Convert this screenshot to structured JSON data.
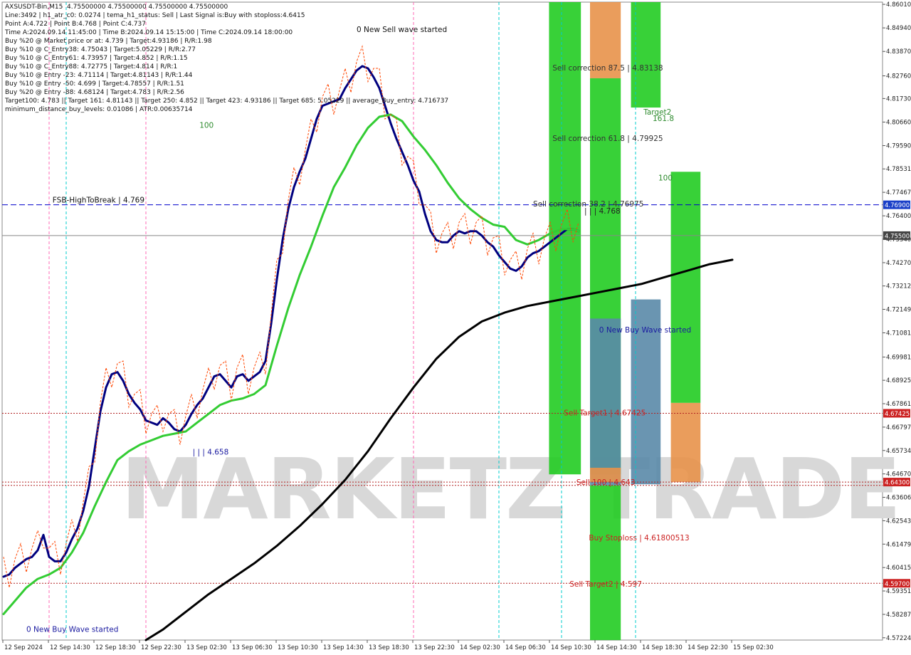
{
  "info_lines": [
    "AXSUSDT-Bin,M15  4.75500000 4.75500000 4.75500000 4.75500000",
    "Line:3492 | h1_atr_c0: 0.0274 | tema_h1_status: Sell | Last Signal is:Buy with stoploss:4.6415",
    "Point A:4.722 | Point B:4.768 | Point C:4.737",
    "Time A:2024.09.14 11:45:00 | Time B:2024.09.14 15:15:00 | Time C:2024.09.14 18:00:00",
    "Buy %20 @ Market price or at: 4.739 | Target:4.93186 | R/R:1.98",
    "Buy %10 @ C_Entry38: 4.75043 | Target:5.05229 | R/R:2.77",
    "Buy %10 @ C_Entry61: 4.73957 | Target:4.852 | R/R:1.15",
    "Buy %10 @ C_Entry88: 4.72775 | Target:4.814 | R/R:1",
    "Buy %10 @ Entry -23: 4.71114 | Target:4.81143 | R/R:1.44",
    "Buy %10 @ Entry -50: 4.699 | Target:4.78557 | R/R:1.51",
    "Buy %20 @ Entry -88: 4.68124 | Target:4.783 | R/R:2.56",
    "Target100: 4.783 || Target 161: 4.81143 || Target 250: 4.852 || Target 423: 4.93186 || Target 685: 5.05229 || average_Buy_entry: 4.716737",
    "minimum_distance_buy_levels: 0.01086 | ATR:0.00635714"
  ],
  "colors": {
    "dark_blue": "#00007f",
    "mid_green": "#33cc33",
    "black_ma": "#000000",
    "orange_dash": "#ff4500",
    "zone_green": "#22cc22",
    "zone_orange": "#e8924a",
    "zone_steel": "#5a8aa8",
    "hline_blue": "#0000cc",
    "hline_red": "#b22222",
    "axis_box_red": "#cc2222",
    "axis_box_blue": "#1a3fc8",
    "axis_box_gray": "#444444",
    "vline_cyan": "#00cccc",
    "vline_pink": "#ff69b4"
  },
  "chart_data": {
    "type": "line",
    "symbol": "AXSUSDT-Bin",
    "timeframe": "M15",
    "y_ticks": [
      "4.86010",
      "4.84940",
      "4.83870",
      "4.82760",
      "4.81730",
      "4.80660",
      "4.79590",
      "4.78531",
      "4.77467",
      "4.76400",
      "4.75340",
      "4.74270",
      "4.73212",
      "4.72149",
      "4.71081",
      "4.69981",
      "4.68925",
      "4.67861",
      "4.66797",
      "4.65734",
      "4.64670",
      "4.63606",
      "4.62543",
      "4.61479",
      "4.60415",
      "4.59351",
      "4.58287",
      "4.57224"
    ],
    "ylim": [
      4.5712,
      4.8611
    ],
    "x_ticks": [
      "12 Sep 2024",
      "12 Sep 14:30",
      "12 Sep 18:30",
      "12 Sep 22:30",
      "13 Sep 02:30",
      "13 Sep 06:30",
      "13 Sep 10:30",
      "13 Sep 14:30",
      "13 Sep 18:30",
      "13 Sep 22:30",
      "14 Sep 02:30",
      "14 Sep 06:30",
      "14 Sep 10:30",
      "14 Sep 14:30",
      "14 Sep 18:30",
      "14 Sep 22:30",
      "15 Sep 02:30"
    ],
    "axis_boxes": [
      {
        "value": "4.76900",
        "color": "#1a3fc8"
      },
      {
        "value": "4.75500",
        "color": "#444444"
      },
      {
        "value": "4.67425",
        "color": "#cc2222"
      },
      {
        "value": "4.64300",
        "color": "#cc2222"
      },
      {
        "value": "4.59700",
        "color": "#cc2222"
      }
    ],
    "series": [
      {
        "key": "tema",
        "color": "#00007f",
        "width": 3,
        "values": [
          [
            0,
            4.6
          ],
          [
            0.5,
            4.601
          ],
          [
            1.0,
            4.604
          ],
          [
            1.5,
            4.606
          ],
          [
            2.0,
            4.608
          ],
          [
            2.5,
            4.609
          ],
          [
            3.0,
            4.612
          ],
          [
            3.5,
            4.619
          ],
          [
            4.0,
            4.609
          ],
          [
            4.5,
            4.607
          ],
          [
            5.0,
            4.607
          ],
          [
            5.5,
            4.611
          ],
          [
            6.0,
            4.617
          ],
          [
            6.5,
            4.622
          ],
          [
            7.0,
            4.63
          ],
          [
            7.5,
            4.641
          ],
          [
            8.0,
            4.658
          ],
          [
            8.5,
            4.675
          ],
          [
            9.0,
            4.686
          ],
          [
            9.5,
            4.692
          ],
          [
            10.0,
            4.693
          ],
          [
            10.5,
            4.689
          ],
          [
            11.0,
            4.683
          ],
          [
            11.5,
            4.679
          ],
          [
            12.0,
            4.676
          ],
          [
            12.5,
            4.671
          ],
          [
            13.0,
            4.67
          ],
          [
            13.5,
            4.669
          ],
          [
            14.0,
            4.672
          ],
          [
            14.5,
            4.67
          ],
          [
            15.0,
            4.667
          ],
          [
            15.5,
            4.666
          ],
          [
            16.0,
            4.669
          ],
          [
            16.5,
            4.674
          ],
          [
            17.0,
            4.678
          ],
          [
            17.5,
            4.681
          ],
          [
            18.0,
            4.686
          ],
          [
            18.5,
            4.691
          ],
          [
            19.0,
            4.692
          ],
          [
            19.5,
            4.689
          ],
          [
            20.0,
            4.686
          ],
          [
            20.5,
            4.691
          ],
          [
            21.0,
            4.692
          ],
          [
            21.5,
            4.689
          ],
          [
            22.0,
            4.691
          ],
          [
            22.5,
            4.693
          ],
          [
            23.0,
            4.698
          ],
          [
            23.5,
            4.715
          ],
          [
            24.0,
            4.735
          ],
          [
            24.5,
            4.753
          ],
          [
            25.0,
            4.767
          ],
          [
            25.5,
            4.777
          ],
          [
            26.0,
            4.784
          ],
          [
            26.5,
            4.79
          ],
          [
            27.0,
            4.799
          ],
          [
            27.5,
            4.808
          ],
          [
            28.0,
            4.814
          ],
          [
            28.5,
            4.815
          ],
          [
            29.0,
            4.816
          ],
          [
            29.5,
            4.817
          ],
          [
            30.0,
            4.822
          ],
          [
            30.5,
            4.826
          ],
          [
            31.0,
            4.83
          ],
          [
            31.5,
            4.832
          ],
          [
            32.0,
            4.831
          ],
          [
            32.5,
            4.827
          ],
          [
            33.0,
            4.822
          ],
          [
            33.5,
            4.814
          ],
          [
            34.0,
            4.806
          ],
          [
            34.5,
            4.799
          ],
          [
            35.0,
            4.793
          ],
          [
            35.5,
            4.787
          ],
          [
            36.0,
            4.78
          ],
          [
            36.5,
            4.775
          ],
          [
            37.0,
            4.765
          ],
          [
            37.5,
            4.757
          ],
          [
            38.0,
            4.753
          ],
          [
            38.5,
            4.752
          ],
          [
            39.0,
            4.752
          ],
          [
            39.5,
            4.755
          ],
          [
            40.0,
            4.757
          ],
          [
            40.5,
            4.756
          ],
          [
            41.0,
            4.757
          ],
          [
            41.5,
            4.757
          ],
          [
            42.0,
            4.755
          ],
          [
            42.5,
            4.752
          ],
          [
            43.0,
            4.75
          ],
          [
            43.5,
            4.746
          ],
          [
            44.0,
            4.743
          ],
          [
            44.5,
            4.74
          ],
          [
            45.0,
            4.739
          ],
          [
            45.5,
            4.741
          ],
          [
            46.0,
            4.745
          ],
          [
            46.5,
            4.747
          ],
          [
            47.0,
            4.748
          ],
          [
            47.5,
            4.75
          ],
          [
            48.0,
            4.752
          ],
          [
            48.5,
            4.754
          ],
          [
            49.0,
            4.756
          ],
          [
            49.5,
            4.758
          ],
          [
            50.0,
            4.758
          ],
          [
            50.5,
            4.757
          ]
        ]
      },
      {
        "key": "ema_mid",
        "color": "#33cc33",
        "width": 3,
        "values": [
          [
            0,
            4.583
          ],
          [
            1,
            4.589
          ],
          [
            2,
            4.595
          ],
          [
            3,
            4.599
          ],
          [
            4,
            4.601
          ],
          [
            5,
            4.604
          ],
          [
            6,
            4.611
          ],
          [
            7,
            4.62
          ],
          [
            8,
            4.632
          ],
          [
            9,
            4.643
          ],
          [
            10,
            4.653
          ],
          [
            11,
            4.657
          ],
          [
            12,
            4.66
          ],
          [
            13,
            4.662
          ],
          [
            14,
            4.664
          ],
          [
            15,
            4.665
          ],
          [
            16,
            4.666
          ],
          [
            17,
            4.67
          ],
          [
            18,
            4.674
          ],
          [
            19,
            4.678
          ],
          [
            20,
            4.68
          ],
          [
            21,
            4.681
          ],
          [
            22,
            4.683
          ],
          [
            23,
            4.687
          ],
          [
            24,
            4.705
          ],
          [
            25,
            4.722
          ],
          [
            26,
            4.737
          ],
          [
            27,
            4.75
          ],
          [
            28,
            4.764
          ],
          [
            29,
            4.777
          ],
          [
            30,
            4.786
          ],
          [
            31,
            4.796
          ],
          [
            32,
            4.804
          ],
          [
            33,
            4.809
          ],
          [
            34,
            4.81
          ],
          [
            35,
            4.807
          ],
          [
            36,
            4.8
          ],
          [
            37,
            4.794
          ],
          [
            38,
            4.787
          ],
          [
            39,
            4.779
          ],
          [
            40,
            4.772
          ],
          [
            41,
            4.767
          ],
          [
            42,
            4.763
          ],
          [
            43,
            4.76
          ],
          [
            44,
            4.759
          ],
          [
            45,
            4.753
          ],
          [
            46,
            4.751
          ],
          [
            47,
            4.753
          ],
          [
            48,
            4.756
          ],
          [
            49,
            4.758
          ],
          [
            50,
            4.758
          ],
          [
            50.5,
            4.757
          ]
        ]
      },
      {
        "key": "ma_slow",
        "color": "#000000",
        "width": 3,
        "values": [
          [
            12.5,
            4.5712
          ],
          [
            14,
            4.576
          ],
          [
            16,
            4.584
          ],
          [
            18,
            4.592
          ],
          [
            20,
            4.599
          ],
          [
            22,
            4.606
          ],
          [
            24,
            4.614
          ],
          [
            26,
            4.623
          ],
          [
            28,
            4.633
          ],
          [
            30,
            4.644
          ],
          [
            32,
            4.657
          ],
          [
            34,
            4.672
          ],
          [
            36,
            4.686
          ],
          [
            38,
            4.699
          ],
          [
            40,
            4.709
          ],
          [
            42,
            4.716
          ],
          [
            44,
            4.72
          ],
          [
            46,
            4.723
          ],
          [
            48,
            4.725
          ],
          [
            50,
            4.727
          ],
          [
            52,
            4.729
          ],
          [
            54,
            4.731
          ],
          [
            56,
            4.733
          ],
          [
            58,
            4.736
          ],
          [
            60,
            4.739
          ],
          [
            62,
            4.742
          ],
          [
            64,
            4.744
          ]
        ]
      }
    ],
    "zones": [
      {
        "x": [
          47.9,
          50.7
        ],
        "y": [
          4.6465,
          4.8611
        ],
        "color": "#22cc22"
      },
      {
        "x": [
          51.5,
          54.2
        ],
        "y": [
          4.8265,
          4.8611
        ],
        "color": "#e8924a"
      },
      {
        "x": [
          51.5,
          54.2
        ],
        "y": [
          4.6465,
          4.8265
        ],
        "color": "#22cc22"
      },
      {
        "x": [
          55.1,
          57.7
        ],
        "y": [
          4.8132,
          4.8611
        ],
        "color": "#22cc22"
      },
      {
        "x": [
          51.5,
          54.2
        ],
        "y": [
          4.6415,
          4.7173
        ],
        "color": "#5a8aa8"
      },
      {
        "x": [
          51.5,
          54.2
        ],
        "y": [
          4.5712,
          4.6415
        ],
        "color": "#22cc22"
      },
      {
        "x": [
          51.5,
          54.2
        ],
        "y": [
          4.643,
          4.6495
        ],
        "color": "#e8924a"
      },
      {
        "x": [
          55.1,
          57.7
        ],
        "y": [
          4.642,
          4.726
        ],
        "color": "#5a8aa8"
      },
      {
        "x": [
          58.6,
          61.2
        ],
        "y": [
          4.643,
          4.679
        ],
        "color": "#e8924a"
      },
      {
        "x": [
          58.6,
          61.2
        ],
        "y": [
          4.679,
          4.784
        ],
        "color": "#22cc22"
      }
    ],
    "h_lines": [
      {
        "y": 4.769,
        "style": "dash",
        "color": "#0000cc"
      },
      {
        "y": 4.755,
        "style": "solid",
        "color": "#888888"
      },
      {
        "y": 4.67425,
        "style": "dot",
        "color": "#b22222"
      },
      {
        "y": 4.643,
        "style": "dot",
        "color": "#b22222"
      },
      {
        "y": 4.6415,
        "style": "dot",
        "color": "#b22222"
      },
      {
        "y": 4.597,
        "style": "dot",
        "color": "#b22222"
      }
    ],
    "v_lines_cyan": [
      5.5,
      43.5,
      49.0,
      55.5
    ],
    "v_lines_pink": [
      4.0,
      12.5,
      36.0
    ],
    "annotations": [
      {
        "text": "0 New Sell wave started",
        "x": 31.0,
        "y": 4.8475,
        "color": "#111111"
      },
      {
        "text": "Sell correction 87.5 | 4.83138",
        "x": 48.2,
        "y": 4.83,
        "color": "#333333"
      },
      {
        "text": "Sell correction 61.8 | 4.79925",
        "x": 48.2,
        "y": 4.798,
        "color": "#333333"
      },
      {
        "text": "Sell correction 38.2 | 4.76975",
        "x": 46.5,
        "y": 4.7682,
        "color": "#333333"
      },
      {
        "text": "| | | 4.768",
        "x": 51.0,
        "y": 4.765,
        "color": "#222222"
      },
      {
        "text": "Target2",
        "x": 56.2,
        "y": 4.81,
        "color": "#2e8b2e"
      },
      {
        "text": "161.8",
        "x": 57.0,
        "y": 4.807,
        "color": "#2e8b2e"
      },
      {
        "text": "100",
        "x": 57.5,
        "y": 4.78,
        "color": "#2e8b2e"
      },
      {
        "text": "100",
        "x": 17.2,
        "y": 4.804,
        "color": "#2e8b2e"
      },
      {
        "text": "FSB-HighToBreak | 4.769",
        "x": 4.3,
        "y": 4.77,
        "color": "#111111"
      },
      {
        "text": "0 New Buy Wave started",
        "x": 52.3,
        "y": 4.711,
        "color": "#1a1aa0"
      },
      {
        "text": "Sell Target1 | 4.67425",
        "x": 49.2,
        "y": 4.6732,
        "color": "#cc2222"
      },
      {
        "text": "Sell 100 | 4.643",
        "x": 50.3,
        "y": 4.6418,
        "color": "#cc2222"
      },
      {
        "text": "Buy Stoploss | 4.61800513",
        "x": 51.4,
        "y": 4.6165,
        "color": "#cc2222"
      },
      {
        "text": "Sell Target2 | 4.597",
        "x": 49.7,
        "y": 4.5955,
        "color": "#cc2222"
      },
      {
        "text": "| | | 4.658",
        "x": 16.6,
        "y": 4.6555,
        "color": "#1a1aa0"
      },
      {
        "text": "0 New Buy Wave started",
        "x": 2.0,
        "y": 4.575,
        "color": "#1a1aa0"
      }
    ]
  },
  "watermark": {
    "text": "MARKETZ TRADE"
  }
}
